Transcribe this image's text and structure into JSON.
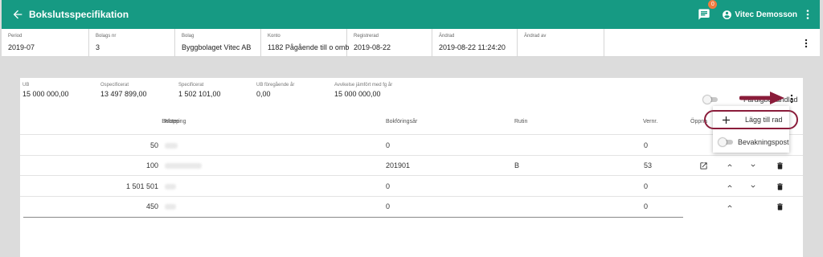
{
  "appbar": {
    "title": "Bokslutsspecifikation",
    "notification_count": "0",
    "user_name": "Vitec Demosson"
  },
  "info": [
    {
      "label": "Period",
      "value": "2019-07"
    },
    {
      "label": "Bolags nr",
      "value": "3"
    },
    {
      "label": "Bolag",
      "value": "Byggbolaget Vitec AB"
    },
    {
      "label": "Konto",
      "value": "1182 Pågående till o omb"
    },
    {
      "label": "Registrerad",
      "value": "2019-08-22"
    },
    {
      "label": "Ändrad",
      "value": "2019-08-22 11:24:20"
    },
    {
      "label": "Ändrad av",
      "value": ""
    }
  ],
  "summary": [
    {
      "label": "UB",
      "value": "15 000 000,00"
    },
    {
      "label": "Ospecificerat",
      "value": "13 497 899,00"
    },
    {
      "label": "Specificerat",
      "value": "1 502 101,00"
    },
    {
      "label": "UB föregående år",
      "value": "0,00"
    },
    {
      "label": "Avvikelse jämfört med fg år",
      "value": "15 000 000,00"
    }
  ],
  "fardig_label": "Färdigbehandlad",
  "columns": {
    "belopp": "Belopp",
    "notering": "Notering",
    "bokforingsar": "Bokföringsår",
    "rutin": "Rutin",
    "vernr": "Vernr.",
    "oppna": "Öppna"
  },
  "rows": [
    {
      "belopp": "50",
      "bokforingsar": "0",
      "rutin": "",
      "vernr": "0"
    },
    {
      "belopp": "100",
      "bokforingsar": "201901",
      "rutin": "B",
      "vernr": "53"
    },
    {
      "belopp": "1 501 501",
      "bokforingsar": "0",
      "rutin": "",
      "vernr": "0"
    },
    {
      "belopp": "450",
      "bokforingsar": "0",
      "rutin": "",
      "vernr": "0"
    }
  ],
  "menu": {
    "add_row": "Lägg till rad",
    "watch_item": "Bevakningspost"
  },
  "colors": {
    "primary": "#169a83",
    "badge": "#f07b3f",
    "annotation": "#8a1c3a"
  },
  "icons": [
    "arrow-left-icon",
    "chat-icon",
    "account-circle-icon",
    "more-vert-icon",
    "open-in-new-icon",
    "chevron-up-icon",
    "chevron-down-icon",
    "delete-icon",
    "plus-icon"
  ]
}
